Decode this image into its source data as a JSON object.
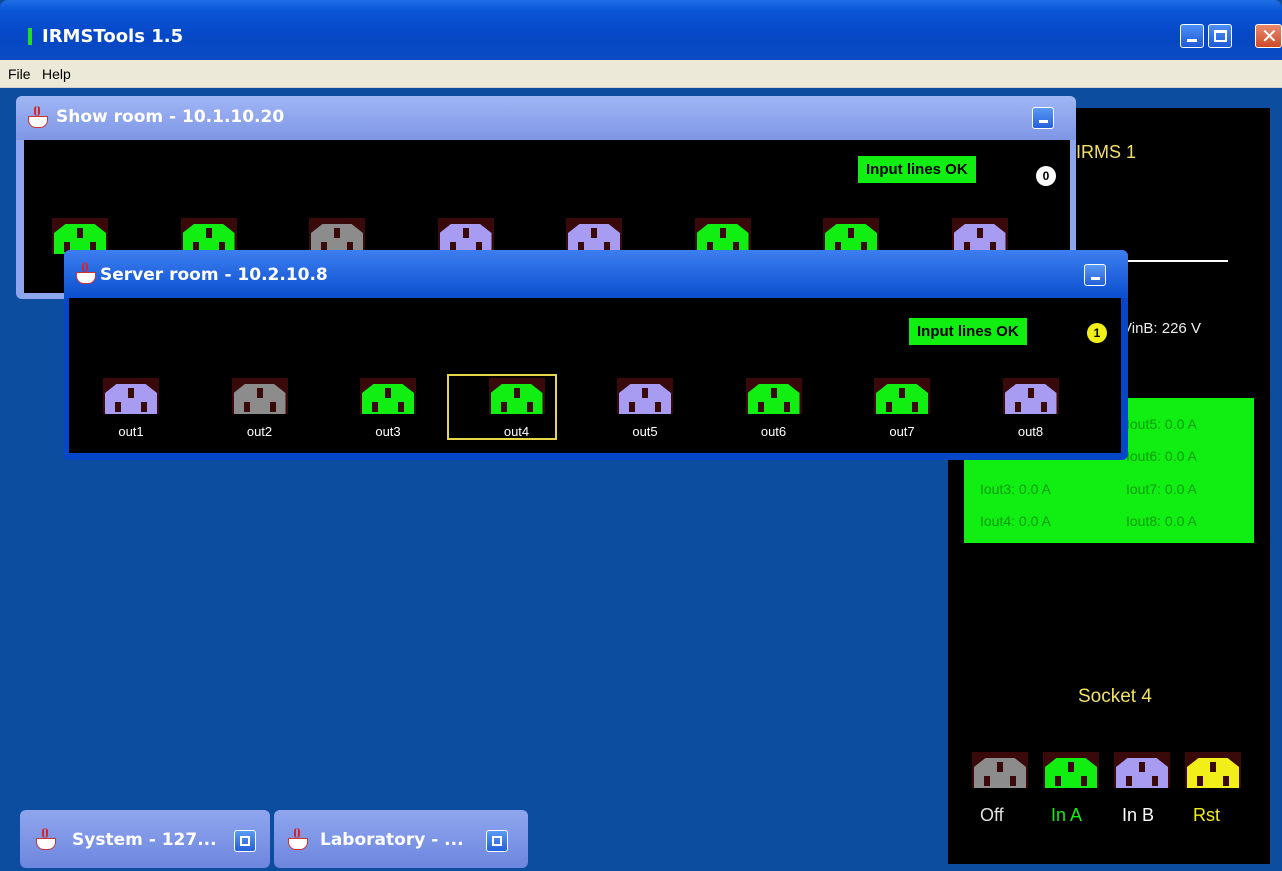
{
  "window": {
    "title": "IRMSTools 1.5"
  },
  "menu": {
    "items": [
      "File",
      "Help"
    ]
  },
  "colors": {
    "green": "#11ee11",
    "grey": "#8c8c8c",
    "violet": "#a79cf2",
    "yellow": "#f2ee1a"
  },
  "show_room": {
    "title": "Show room - 10.1.10.20",
    "status": "Input lines OK",
    "badge": "0",
    "sockets": [
      {
        "color": "green"
      },
      {
        "color": "green"
      },
      {
        "color": "grey"
      },
      {
        "color": "violet"
      },
      {
        "color": "violet"
      },
      {
        "color": "green"
      },
      {
        "color": "green"
      },
      {
        "color": "violet"
      }
    ]
  },
  "server_room": {
    "title": "Server room - 10.2.10.8",
    "status": "Input lines OK",
    "badge": "1",
    "selected": "out4",
    "sockets": [
      {
        "label": "out1",
        "color": "violet"
      },
      {
        "label": "out2",
        "color": "grey"
      },
      {
        "label": "out3",
        "color": "green"
      },
      {
        "label": "out4",
        "color": "green"
      },
      {
        "label": "out5",
        "color": "violet"
      },
      {
        "label": "out6",
        "color": "green"
      },
      {
        "label": "out7",
        "color": "green"
      },
      {
        "label": "out8",
        "color": "violet"
      }
    ]
  },
  "detail": {
    "device": "IRMS 1",
    "vinb": "VinB: 226 V",
    "currents": {
      "iout3": "Iout3: 0.0 A",
      "iout4": "Iout4: 0.0 A",
      "iout5": "Iout5: 0.0 A",
      "iout6": "Iout6: 0.0 A",
      "iout7": "Iout7: 0.0 A",
      "iout8": "Iout8: 0.0 A"
    },
    "socket_title": "Socket 4",
    "buttons": [
      {
        "label": "Off",
        "color": "grey",
        "label_color": "#e0e0e0"
      },
      {
        "label": "In A",
        "color": "green",
        "label_color": "#11ee11"
      },
      {
        "label": "In B",
        "color": "violet",
        "label_color": "#ffffff"
      },
      {
        "label": "Rst",
        "color": "yellow",
        "label_color": "#f2ee1a"
      }
    ]
  },
  "minimized": [
    {
      "title": "System - 127..."
    },
    {
      "title": "Laboratory - ..."
    }
  ]
}
